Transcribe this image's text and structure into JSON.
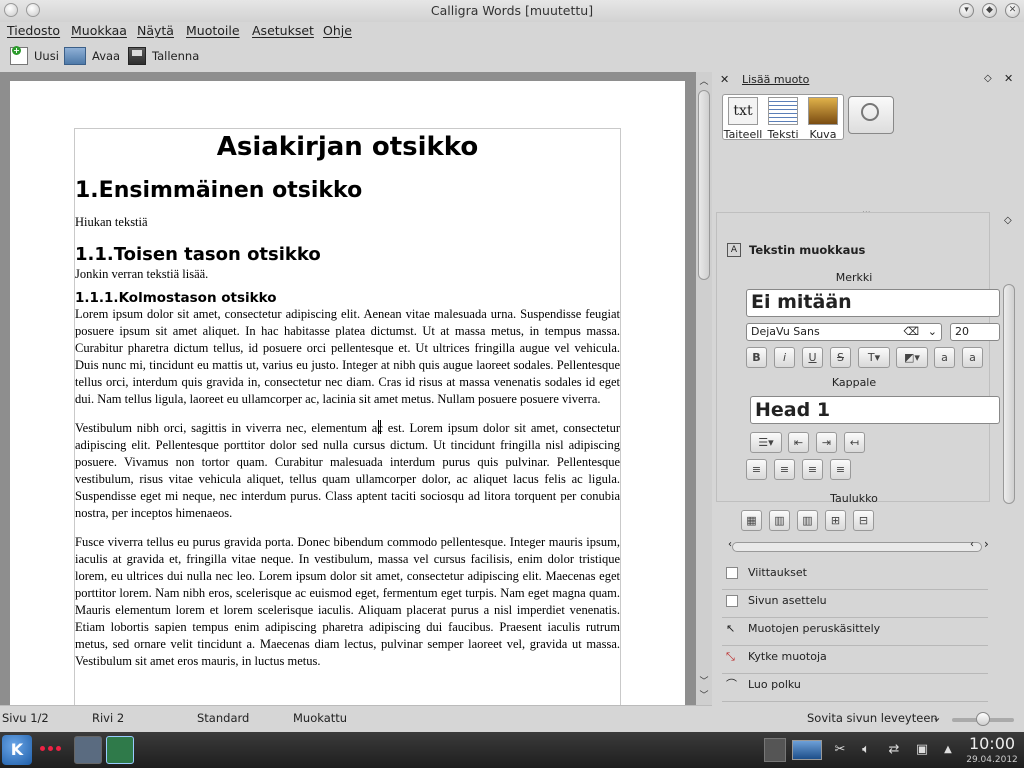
{
  "window": {
    "title": "Calligra Words [muutettu]"
  },
  "menubar": {
    "items": [
      "Tiedosto",
      "Muokkaa",
      "Näytä",
      "Muotoile",
      "Asetukset",
      "Ohje"
    ]
  },
  "toolbar": {
    "new_label": "Uusi",
    "open_label": "Avaa",
    "save_label": "Tallenna"
  },
  "document": {
    "title": "Asiakirjan otsikko",
    "h1": "1.Ensimmäinen otsikko",
    "p1": "Hiukan tekstiä",
    "h2": "1.1.Toisen tason otsikko",
    "p2": "Jonkin verran tekstiä lisää.",
    "h3": "1.1.1.Kolmostason otsikko",
    "p3": "Lorem ipsum dolor sit amet, consectetur adipiscing elit. Aenean vitae malesuada urna. Suspendisse feugiat posuere ipsum sit amet aliquet. In hac habitasse platea dictumst. Ut at massa metus, in tempus massa. Curabitur pharetra dictum tellus, id posuere orci pellentesque et. Ut ultrices fringilla augue vel vehicula. Duis nunc mi, tincidunt eu mattis ut, varius eu justo. Integer at nibh quis augue laoreet sodales. Pellentesque tellus orci, interdum quis gravida in, consectetur nec diam. Cras id risus at massa venenatis sodales id eget dui. Nam tellus ligula, laoreet eu ullamcorper ac, lacinia sit amet metus. Nullam posuere posuere viverra.",
    "p4": "Vestibulum nibh orci, sagittis in viverra nec, elementum ac est. Lorem ipsum dolor sit amet, consectetur adipiscing elit. Pellentesque porttitor dolor sed nulla cursus dictum. Ut tincidunt fringilla nisl adipiscing posuere. Vivamus non tortor quam. Curabitur malesuada interdum purus quis pulvinar. Pellentesque vestibulum, risus vitae vehicula aliquet, tellus quam ullamcorper dolor, ac aliquet lacus felis ac ligula. Suspendisse eget mi neque, nec interdum purus. Class aptent taciti sociosqu ad litora torquent per conubia nostra, per inceptos himenaeos.",
    "p5": "Fusce viverra tellus eu purus gravida porta. Donec bibendum commodo pellentesque. Integer mauris ipsum, iaculis at gravida et, fringilla vitae neque. In vestibulum, massa vel cursus facilisis, enim dolor tristique lorem, eu ultrices dui nulla nec leo. Lorem ipsum dolor sit amet, consectetur adipiscing elit. Maecenas eget porttitor lorem. Nam nibh eros, scelerisque ac euismod eget, fermentum eget turpis. Nam eget magna quam. Mauris elementum lorem et lorem scelerisque iaculis. Aliquam placerat purus a nisl imperdiet venenatis. Etiam lobortis sapien tempus enim adipiscing pharetra adipiscing dui faucibus. Praesent iaculis rutrum metus, sed ornare velit tincidunt a. Maecenas diam lectus, pulvinar semper laoreet vel, gravida ut massa. Vestibulum sit amet eros mauris, in luctus metus."
  },
  "dock": {
    "add_shape_title": "Lisää muoto",
    "shapes": [
      "Taiteell",
      "Teksti",
      "Kuva"
    ],
    "text_edit_title": "Tekstin muokkaus",
    "char_section": "Merkki",
    "char_style": "Ei mitään",
    "font_name": "DejaVu Sans",
    "font_size": "20",
    "para_section": "Kappale",
    "para_style": "Head 1",
    "table_section": "Taulukko",
    "items": [
      "Viittaukset",
      "Sivun asettelu",
      "Muotojen peruskäsittely",
      "Kytke muotoja",
      "Luo polku"
    ]
  },
  "statusbar": {
    "page": "Sivu 1/2",
    "line": "Rivi 2",
    "style": "Standard",
    "modified": "Muokattu",
    "zoom": "Sovita sivun leveyteen"
  },
  "taskbar": {
    "time": "10:00",
    "date": "29.04.2012"
  }
}
